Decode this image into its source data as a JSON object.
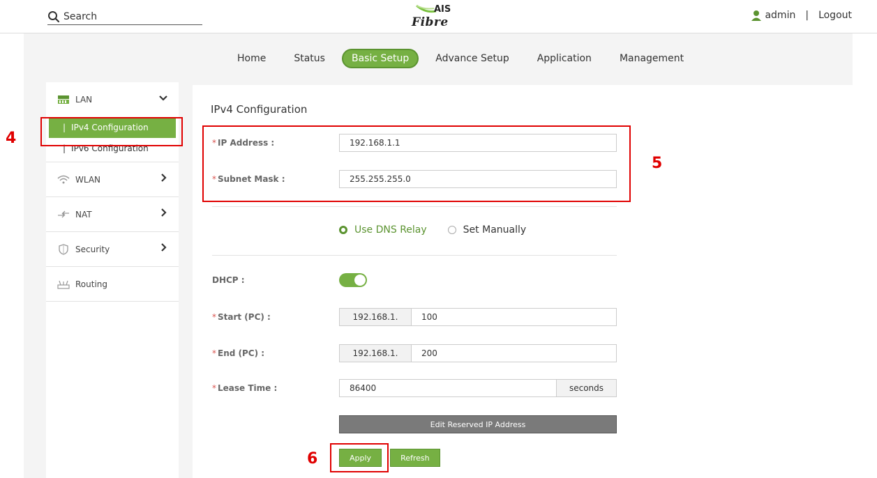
{
  "header": {
    "search_placeholder": "Search",
    "logo_top": "AIS",
    "logo_bottom": "Fibre",
    "user": "admin",
    "separator": "|",
    "logout": "Logout"
  },
  "nav": {
    "items": [
      {
        "label": "Home",
        "active": false
      },
      {
        "label": "Status",
        "active": false
      },
      {
        "label": "Basic Setup",
        "active": true
      },
      {
        "label": "Advance Setup",
        "active": false
      },
      {
        "label": "Application",
        "active": false
      },
      {
        "label": "Management",
        "active": false
      }
    ]
  },
  "sidebar": {
    "lan": {
      "label": "LAN",
      "icon": "lan-icon",
      "expanded": true
    },
    "sub_items": [
      {
        "label": "IPv4 Configuration",
        "bar": "|",
        "active": true
      },
      {
        "label": "IPv6 Configuration",
        "bar": "|",
        "active": false
      }
    ],
    "items": [
      {
        "label": "WLAN",
        "icon": "wifi-icon",
        "arrow": true
      },
      {
        "label": "NAT",
        "icon": "nat-icon",
        "arrow": true
      },
      {
        "label": "Security",
        "icon": "shield-icon",
        "arrow": true
      },
      {
        "label": "Routing",
        "icon": "router-icon",
        "arrow": false
      }
    ]
  },
  "form": {
    "title": "IPv4 Configuration",
    "required_mark": "*",
    "ip_label": "IP Address :",
    "ip_value": "192.168.1.1",
    "mask_label": "Subnet Mask :",
    "mask_value": "255.255.255.0",
    "dns_relay_label": "Use DNS Relay",
    "set_manually_label": "Set Manually",
    "dns_mode": "relay",
    "dhcp_label": "DHCP :",
    "dhcp_on": true,
    "start_label": "Start (PC) :",
    "start_prefix": "192.168.1.",
    "start_value": "100",
    "end_label": "End (PC) :",
    "end_prefix": "192.168.1.",
    "end_value": "200",
    "lease_label": "Lease Time :",
    "lease_value": "86400",
    "lease_unit": "seconds",
    "edit_reserved_label": "Edit Reserved IP Address",
    "apply_label": "Apply",
    "refresh_label": "Refresh"
  },
  "annotations": {
    "n4": "4",
    "n5": "5",
    "n6": "6",
    "color": "#e00000"
  },
  "colors": {
    "accent": "#76b043",
    "accent_dark": "#5b9330"
  }
}
